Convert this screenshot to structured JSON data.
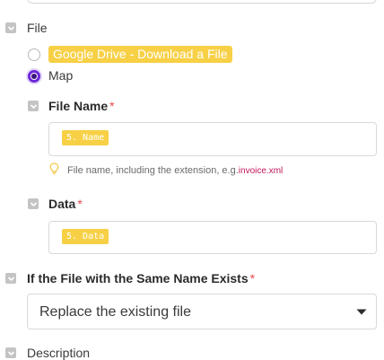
{
  "file_section": {
    "label": "File",
    "option_google_drive": "Google Drive - Download a File",
    "option_map": "Map",
    "file_name": {
      "label": "File Name",
      "required_mark": "*",
      "value_chip": "5. Name",
      "hint_text": "File name, including the extension, e.g.",
      "hint_example": "invoice.xml"
    },
    "data": {
      "label": "Data",
      "required_mark": "*",
      "value_chip": "5. Data"
    }
  },
  "same_name_section": {
    "label": "If the File with the Same Name Exists",
    "required_mark": "*",
    "selected_option": "Replace the existing file"
  },
  "description_section": {
    "label": "Description"
  },
  "colors": {
    "accent_purple": "#6d28d9",
    "chip_yellow": "#f7d046",
    "required_red": "#e5484d",
    "hint_link": "#c2185b"
  }
}
